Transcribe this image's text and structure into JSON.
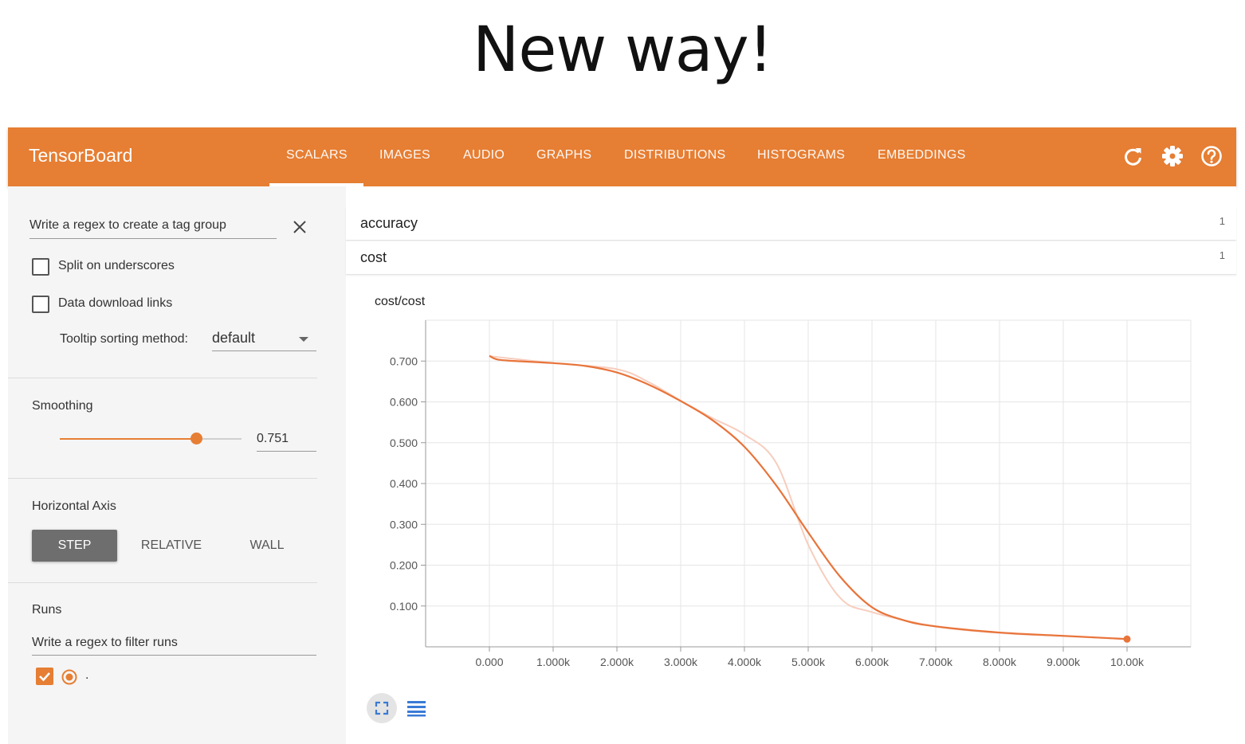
{
  "slide": {
    "title": "New way!"
  },
  "header": {
    "brand": "TensorBoard",
    "tabs": [
      {
        "label": "SCALARS",
        "active": true
      },
      {
        "label": "IMAGES"
      },
      {
        "label": "AUDIO"
      },
      {
        "label": "GRAPHS"
      },
      {
        "label": "DISTRIBUTIONS"
      },
      {
        "label": "HISTOGRAMS"
      },
      {
        "label": "EMBEDDINGS"
      }
    ],
    "icons": [
      "refresh-icon",
      "settings-gear-icon",
      "help-circle-icon"
    ],
    "color": "#e67e33"
  },
  "sidebar": {
    "tag_group_placeholder": "Write a regex to create a tag group",
    "split_underscores": {
      "label": "Split on underscores",
      "checked": false
    },
    "download_links": {
      "label": "Data download links",
      "checked": false
    },
    "tooltip_sorting": {
      "label": "Tooltip sorting method:",
      "value": "default"
    },
    "smoothing": {
      "label": "Smoothing",
      "value": "0.751",
      "fraction": 0.751
    },
    "horizontal_axis": {
      "label": "Horizontal Axis",
      "options": [
        "STEP",
        "RELATIVE",
        "WALL"
      ],
      "selected": "STEP"
    },
    "runs": {
      "label": "Runs",
      "filter_placeholder": "Write a regex to filter runs",
      "items": [
        {
          "name": ".",
          "checked": true,
          "color": "#e67e33"
        }
      ]
    }
  },
  "main": {
    "tags": [
      {
        "name": "accuracy",
        "count": "1"
      },
      {
        "name": "cost",
        "count": "1"
      }
    ],
    "chart_title": "cost/cost"
  },
  "chart_data": {
    "type": "line",
    "title": "cost/cost",
    "xlabel": "",
    "ylabel": "",
    "xlim": [
      -1000,
      11000
    ],
    "ylim": [
      0,
      0.8
    ],
    "x_ticks": [
      "0.000",
      "1.000k",
      "2.000k",
      "3.000k",
      "4.000k",
      "5.000k",
      "6.000k",
      "7.000k",
      "8.000k",
      "9.000k",
      "10.00k"
    ],
    "y_ticks": [
      "0.700",
      "0.600",
      "0.500",
      "0.400",
      "0.300",
      "0.200",
      "0.100"
    ],
    "grid": true,
    "series": [
      {
        "color": "#e8743b",
        "x": [
          0,
          100,
          300,
          1000,
          1500,
          2000,
          2500,
          3000,
          3500,
          4000,
          4500,
          5000,
          5500,
          6000,
          6500,
          7000,
          8000,
          9000,
          10000
        ],
        "y": [
          0.713,
          0.705,
          0.701,
          0.695,
          0.688,
          0.672,
          0.642,
          0.602,
          0.555,
          0.49,
          0.395,
          0.28,
          0.172,
          0.097,
          0.065,
          0.05,
          0.035,
          0.027,
          0.019
        ]
      },
      {
        "color": "#f7cdbd",
        "x": [
          0,
          1000,
          2000,
          2500,
          3000,
          3500,
          4000,
          4500,
          5000,
          5500,
          6000,
          7000,
          8000,
          9000,
          10000
        ],
        "y": [
          0.712,
          0.695,
          0.68,
          0.648,
          0.603,
          0.56,
          0.52,
          0.45,
          0.25,
          0.12,
          0.085,
          0.05,
          0.034,
          0.026,
          0.019
        ]
      }
    ]
  }
}
